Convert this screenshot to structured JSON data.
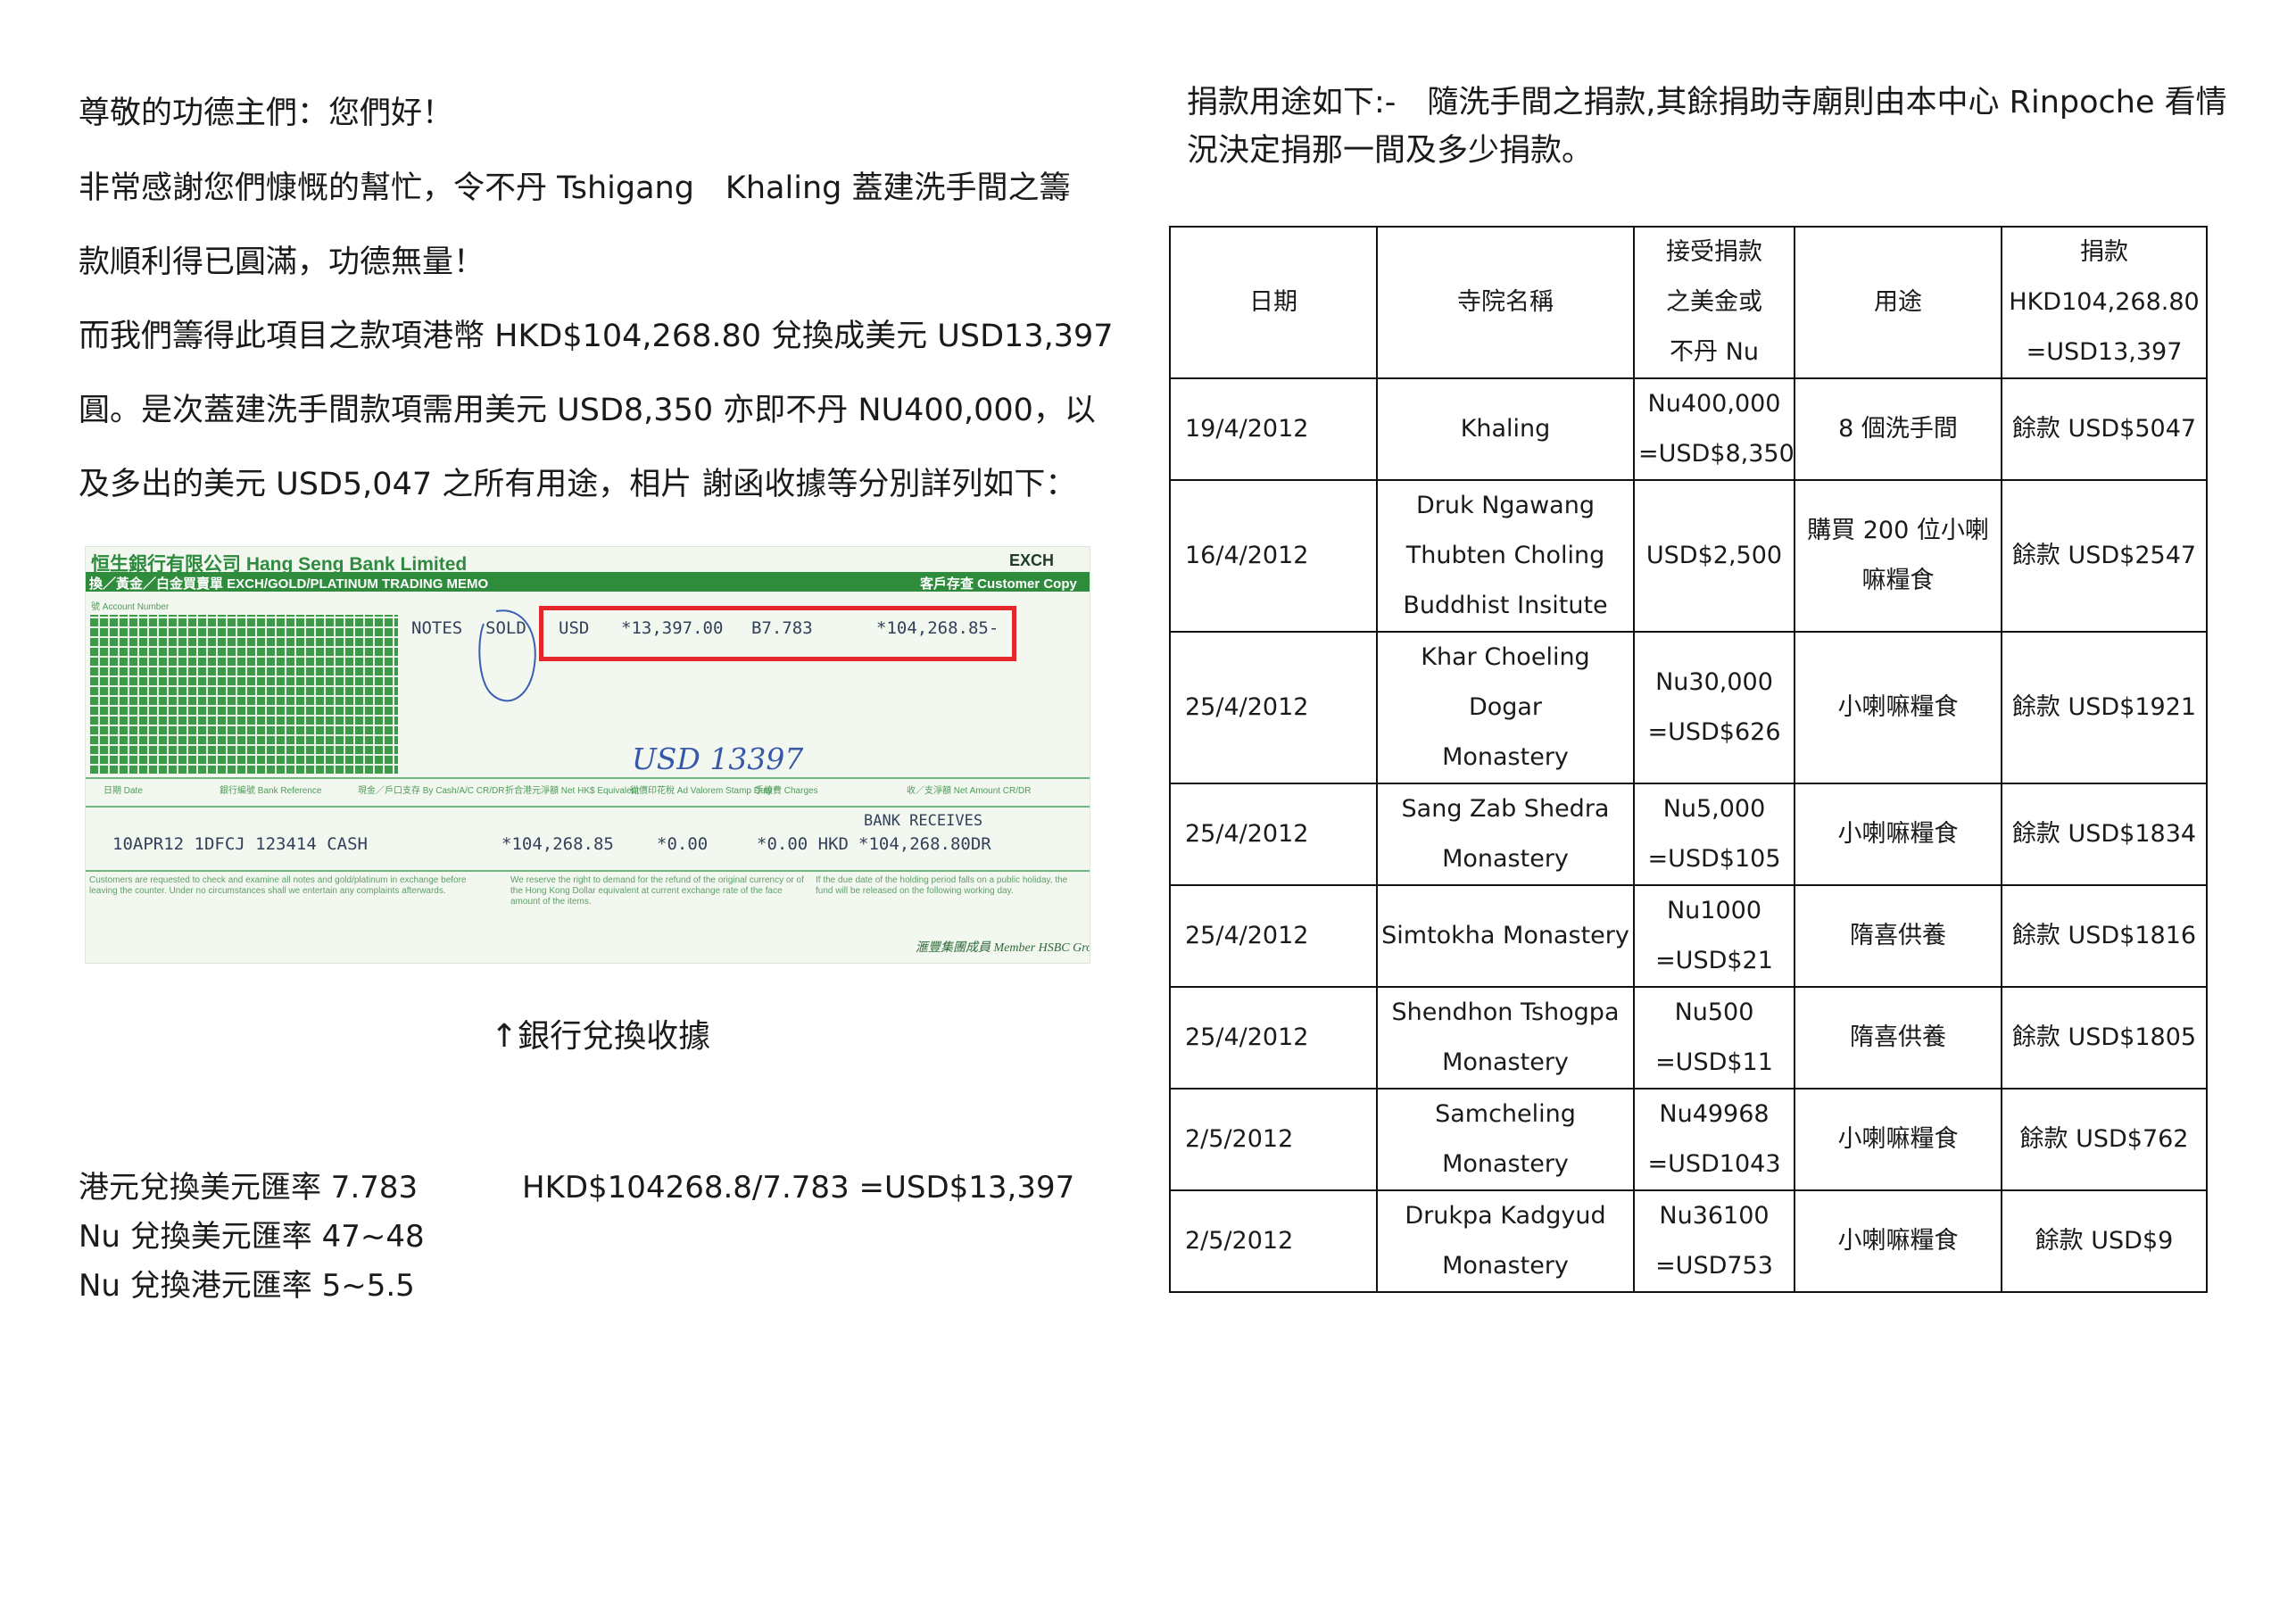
{
  "letter": {
    "lines": [
      "尊敬的功德主們：您們好！",
      "非常感謝您們慷慨的幫忙，令不丹 Tshigang　Khaling 蓋建洗手間之籌",
      "款順利得已圓滿，功德無量！",
      "而我們籌得此項目之款項港幣 HKD$104,268.80 兌換成美元 USD13,397",
      "圓。是次蓋建洗手間款項需用美元 USD8,350 亦即不丹 NU400,000，以",
      "及多出的美元 USD5,047 之所有用途，相片 謝函收據等分別詳列如下："
    ],
    "caption": "↑銀行兌換收據",
    "rates": {
      "hkd_usd": "港元兌換美元匯率 7.783",
      "formula": "HKD$104268.8/7.783 =USD$13,397",
      "nu_usd": "Nu 兌換美元匯率 47~48",
      "nu_hkd": "Nu 兌換港元匯率 5~5.5"
    }
  },
  "receipt": {
    "bank_name": "恒生銀行有限公司 Hang Seng Bank Limited",
    "tag": "EXCH",
    "memo_title": "換／黃金／白金買賣單 EXCH/GOLD/PLATINUM TRADING MEMO",
    "copy_label": "客戶存查 Customer Copy",
    "account_label": "號 Account Number",
    "notes": "NOTES",
    "sold": "SOLD",
    "currency": "USD",
    "foreign_amount": "*13,397.00",
    "rate": "B7.783",
    "hkd_amount": "*104,268.85-",
    "handwritten": "USD 13397",
    "col_date": "日期 Date",
    "col_ref": "銀行編號 Bank Reference",
    "col_cash": "現金／戶口支存 By Cash/A/C CR/DR",
    "col_net": "折合港元淨額 Net HK$ Equivalent",
    "col_stamp": "從價印花稅 Ad Valorem Stamp Duty",
    "col_charges": "手續費 Charges",
    "col_netamt": "收／支淨額 Net Amount CR/DR",
    "bank_receives": "BANK RECEIVES",
    "row_date_ref": "10APR12 1DFCJ 123414 CASH",
    "row_net": "*104,268.85",
    "row_stamp": "*0.00",
    "row_charges": "*0.00 HKD",
    "row_total": "*104,268.80DR",
    "fine_1": "Customers are requested to check and examine all notes and gold/platinum in exchange before leaving the counter. Under no circumstances shall we entertain any complaints afterwards.",
    "fine_2": "We reserve the right to demand for the refund of the original currency or of the Hong Kong Dollar equivalent at current exchange rate of the face amount of the items.",
    "fine_3": "If the due date of the holding period falls on a public holiday, the fund will be released on the following working day.",
    "member": "滙豐集團成員 Member HSBC Group"
  },
  "intro": {
    "line1": "捐款用途如下:-　隨洗手間之捐款,其餘捐助寺廟則由本中心 Rinpoche 看情",
    "line2": "況決定捐那一間及多少捐款。"
  },
  "table": {
    "headers": {
      "date": "日期",
      "temple": "寺院名稱",
      "received": [
        "接受捐款",
        "之美金或",
        "不丹 Nu"
      ],
      "purpose": "用途",
      "donation": [
        "捐款",
        "HKD104,268.80",
        "=USD13,397"
      ]
    },
    "rows": [
      {
        "date": "19/4/2012",
        "temple": [
          "Khaling"
        ],
        "received": [
          "Nu400,000",
          "=USD$8,350"
        ],
        "purpose": [
          "8 個洗手間"
        ],
        "balance": "餘款 USD$5047"
      },
      {
        "date": "16/4/2012",
        "temple": [
          "Druk Ngawang",
          "Thubten Choling",
          "Buddhist Insitute"
        ],
        "received": [
          "USD$2,500"
        ],
        "purpose": [
          "購買 200 位小喇",
          "嘛糧食"
        ],
        "balance": "餘款 USD$2547"
      },
      {
        "date": "25/4/2012",
        "temple": [
          "Khar Choeling Dogar",
          "Monastery"
        ],
        "received": [
          "Nu30,000",
          "=USD$626"
        ],
        "purpose": [
          "小喇嘛糧食"
        ],
        "balance": "餘款 USD$1921"
      },
      {
        "date": "25/4/2012",
        "temple": [
          "Sang Zab Shedra",
          "Monastery"
        ],
        "received": [
          "Nu5,000",
          "=USD$105"
        ],
        "purpose": [
          "小喇嘛糧食"
        ],
        "balance": "餘款 USD$1834"
      },
      {
        "date": "25/4/2012",
        "temple": [
          "Simtokha Monastery"
        ],
        "received": [
          "Nu1000",
          "=USD$21"
        ],
        "purpose": [
          "隋喜供養"
        ],
        "balance": "餘款 USD$1816"
      },
      {
        "date": "25/4/2012",
        "temple": [
          "Shendhon Tshogpa",
          "Monastery"
        ],
        "received": [
          "Nu500",
          "=USD$11"
        ],
        "purpose": [
          "隋喜供養"
        ],
        "balance": "餘款 USD$1805"
      },
      {
        "date": "2/5/2012",
        "temple": [
          "Samcheling",
          "Monastery"
        ],
        "received": [
          "Nu49968",
          "=USD1043"
        ],
        "purpose": [
          "小喇嘛糧食"
        ],
        "balance": "餘款 USD$762"
      },
      {
        "date": "2/5/2012",
        "temple": [
          "Drukpa Kadgyud",
          "Monastery"
        ],
        "received": [
          "Nu36100",
          "=USD753"
        ],
        "purpose": [
          "小喇嘛糧食"
        ],
        "balance": "餘款 USD$9"
      }
    ]
  }
}
